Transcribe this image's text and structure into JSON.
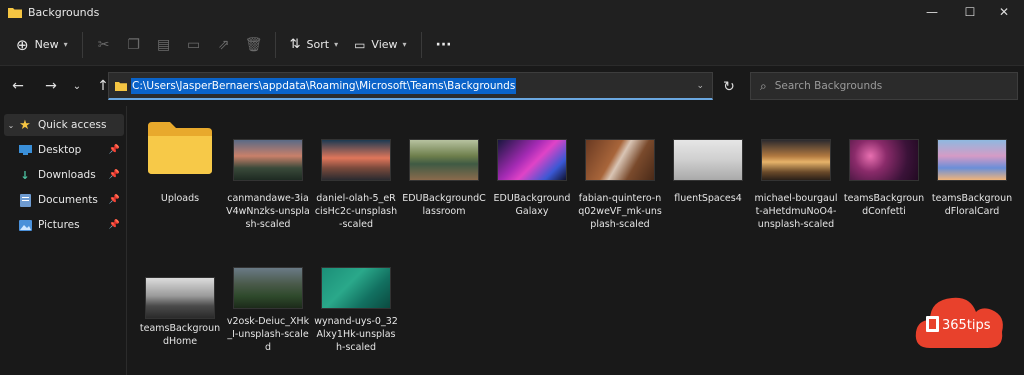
{
  "window": {
    "title": "Backgrounds"
  },
  "toolbar": {
    "new_label": "New",
    "sort_label": "Sort",
    "view_label": "View",
    "more_label": "···"
  },
  "address": {
    "path": "C:\\Users\\JasperBernaers\\appdata\\Roaming\\Microsoft\\Teams\\Backgrounds",
    "search_placeholder": "Search Backgrounds"
  },
  "sidebar": {
    "items": [
      {
        "label": "Quick access"
      },
      {
        "label": "Desktop"
      },
      {
        "label": "Downloads"
      },
      {
        "label": "Documents"
      },
      {
        "label": "Pictures"
      }
    ]
  },
  "files": [
    {
      "name": "Uploads"
    },
    {
      "name": "canmandawe-3iaV4wNnzks-unsplash-scaled"
    },
    {
      "name": "daniel-olah-5_eRcisHc2c-unsplash-scaled"
    },
    {
      "name": "EDUBackgroundClassroom"
    },
    {
      "name": "EDUBackgroundGalaxy"
    },
    {
      "name": "fabian-quintero-nq02weVF_mk-unsplash-scaled"
    },
    {
      "name": "fluentSpaces4"
    },
    {
      "name": "michael-bourgault-aHetdmuNoO4-unsplash-scaled"
    },
    {
      "name": "teamsBackgroundConfetti"
    },
    {
      "name": "teamsBackgroundFloralCard"
    },
    {
      "name": "teamsBackgroundHome"
    },
    {
      "name": "v2osk-Deiuc_XHk_I-unsplash-scaled"
    },
    {
      "name": "wynand-uys-0_32Alxy1Hk-unsplash-scaled"
    }
  ],
  "brand": {
    "text": "365tips"
  },
  "colors": {
    "accent": "#0a63c9",
    "folder": "#f5c542",
    "brand_red": "#e8412c"
  }
}
